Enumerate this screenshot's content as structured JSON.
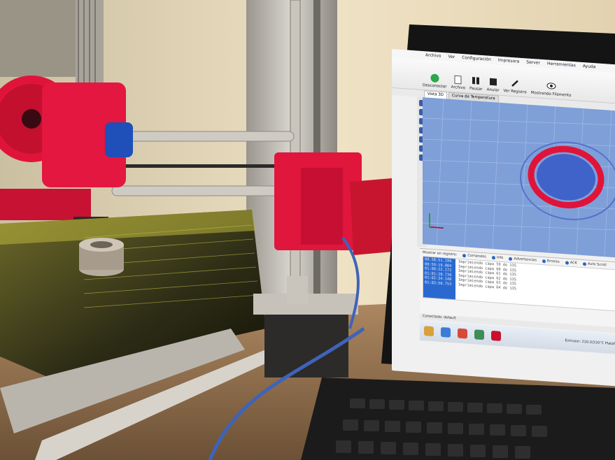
{
  "scene": "3d-printer-with-laptop",
  "laptop_ui": {
    "menu": [
      "Archivo",
      "Ver",
      "Configuración",
      "Impresora",
      "Server",
      "Herramientas",
      "Ayuda"
    ],
    "toolbar": [
      {
        "label": "Desconectar",
        "icon": "power-icon"
      },
      {
        "label": "Archivo",
        "icon": "file-icon"
      },
      {
        "label": "Pausar",
        "icon": "pause-icon"
      },
      {
        "label": "Anular",
        "icon": "stop-icon"
      },
      {
        "label": "Ver Registro",
        "icon": "pencil-icon"
      },
      {
        "label": "Mostrando Filamento",
        "icon": "eye-icon"
      }
    ],
    "tabs": [
      "Vista 3D",
      "Curva de Temperatura"
    ],
    "log": {
      "title": "Mostrar en registro:",
      "filters": [
        "Comandos",
        "Info",
        "Advertencias",
        "Errores",
        "ACK",
        "Auto Scroll"
      ],
      "timestamps": [
        "00:58:51.199",
        "00:59:19.004",
        "01:00:22.172",
        "01:01:28.739",
        "01:02:34.148",
        "01:03:50.753"
      ],
      "messages": [
        "Imprimiendo capa 59 de 135",
        "Imprimiendo capa 60 de 135",
        "Imprimiendo capa 61 de 135",
        "Imprimiendo capa 62 de 135",
        "Imprimiendo capa 63 de 135",
        "Imprimiendo capa 64 de 135"
      ]
    },
    "status_left": "Conectado: default",
    "status_right": "Extrusor: 220.0/220°C Plataforma"
  },
  "colors": {
    "wall": "#e9d9b6",
    "printed_red": "#e0143a",
    "filament_blue": "#2b6fd6",
    "bed_yellow": "#c7c23a",
    "view_blue": "#7f9fd8"
  }
}
